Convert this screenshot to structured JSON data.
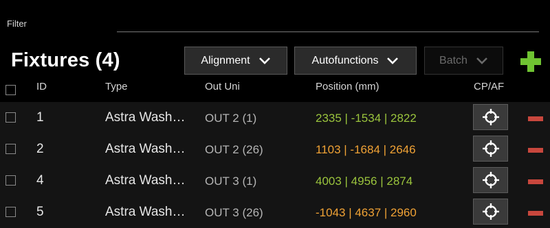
{
  "filter": {
    "label": "Filter",
    "value": "",
    "placeholder": ""
  },
  "title": "Fixtures (4)",
  "toolbar": {
    "alignment_label": "Alignment",
    "autofunctions_label": "Autofunctions",
    "batch_label": "Batch"
  },
  "table": {
    "columns": {
      "id": "ID",
      "type": "Type",
      "out_uni": "Out Uni",
      "position": "Position (mm)",
      "cpaf": "CP/AF"
    },
    "rows": [
      {
        "id": "1",
        "type": "Astra Wash…",
        "out_uni": "OUT 2 (1)",
        "position": "2335 | -1534 | 2822",
        "position_color": "#9bc53d"
      },
      {
        "id": "2",
        "type": "Astra Wash…",
        "out_uni": "OUT 2 (26)",
        "position": "1103 | -1684 | 2646",
        "position_color": "#f0a235"
      },
      {
        "id": "4",
        "type": "Astra Wash…",
        "out_uni": "OUT 3 (1)",
        "position": "4003 | 4956 | 2874",
        "position_color": "#9bc53d"
      },
      {
        "id": "5",
        "type": "Astra Wash…",
        "out_uni": "OUT 3 (26)",
        "position": "-1043 | 4637 | 2960",
        "position_color": "#f0a235"
      }
    ]
  },
  "icons": {
    "dropdown": "chevron-down-icon",
    "add": "plus-icon",
    "cpaf": "crosshair-icon",
    "remove": "minus-icon"
  },
  "colors": {
    "add": "#6fc332",
    "remove": "#c8473d",
    "position_ok": "#9bc53d",
    "position_warn": "#f0a235"
  }
}
